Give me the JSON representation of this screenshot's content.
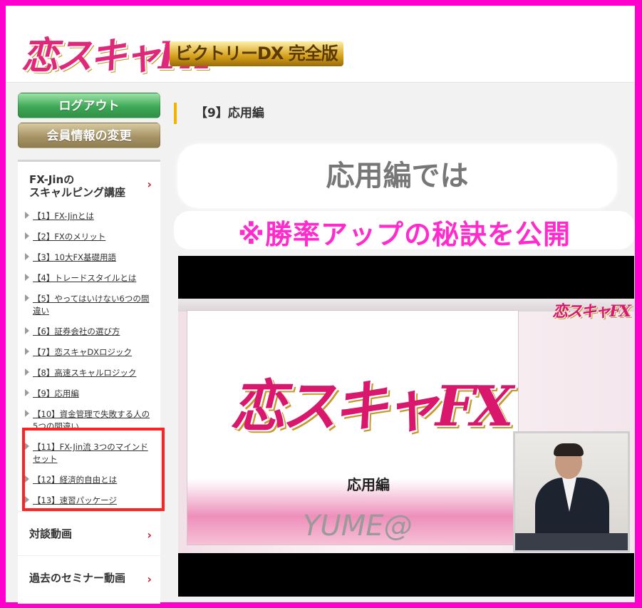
{
  "header": {
    "logo_main": "恋スキャFX",
    "logo_sub": "ビクトリーDX 完全版"
  },
  "sidebar": {
    "logout_label": "ログアウト",
    "member_label": "会員情報の変更",
    "course_title_line1": "FX-Jinの",
    "course_title_line2": "スキャルピング講座",
    "items": [
      "【1】FX-Jinとは",
      "【2】FXのメリット",
      "【3】10大FX基礎用語",
      "【4】トレードスタイルとは",
      "【5】やってはいけない6つの間違い",
      "【6】証券会社の選び方",
      "【7】恋スキャDXロジック",
      "【8】高速スキャルロジック",
      "【9】応用編",
      "【10】資金管理で失敗する人の5つの間違い",
      "【11】FX-Jin流 3つのマインドセット",
      "【12】経済的自由とは",
      "【13】速習パッケージ"
    ],
    "section_talk": "対談動画",
    "section_seminar": "過去のセミナー動画",
    "chevron": "›"
  },
  "main": {
    "page_title": "【9】応用編",
    "bubble1_text": "応用編では",
    "bubble2_text": "※勝率アップの秘訣を公開"
  },
  "video": {
    "slide_logo": "恋スキャFX",
    "slide_title": "応用編",
    "mini_logo": "恋スキャFX",
    "watermark": "YUME@"
  }
}
